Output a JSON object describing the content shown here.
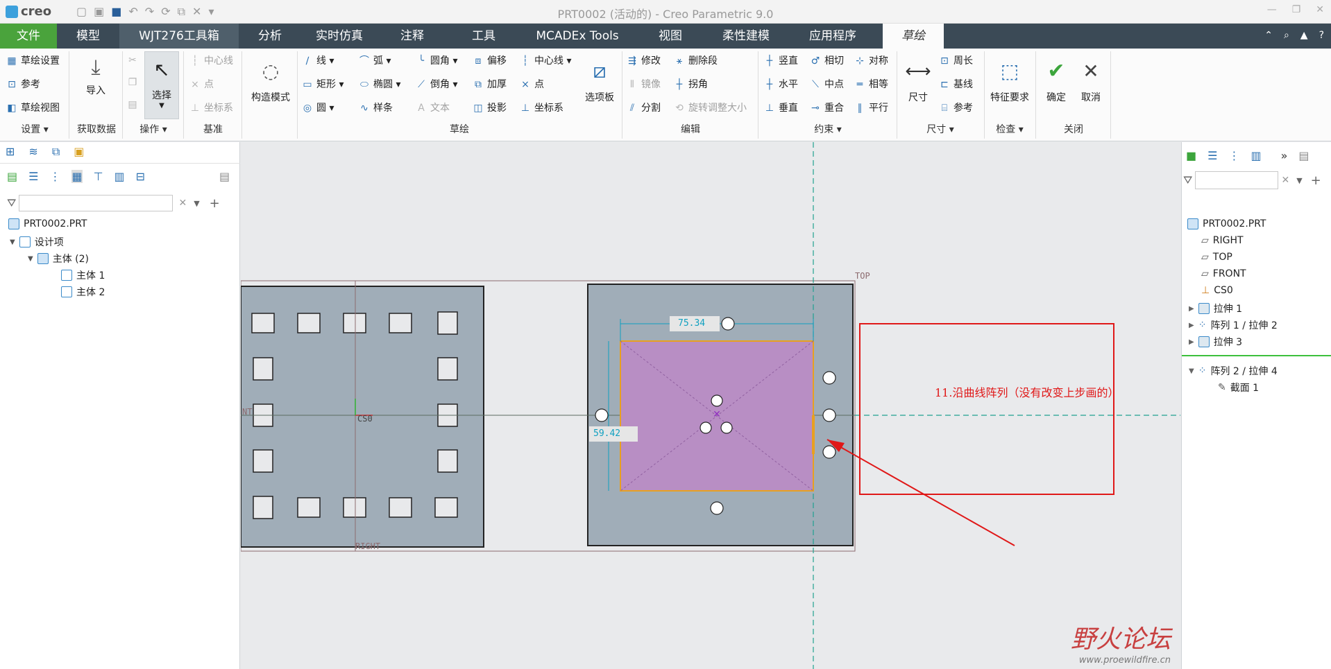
{
  "app": {
    "logo": "creo",
    "title": "PRT0002 (活动的) - Creo Parametric 9.0"
  },
  "tabs": [
    "文件",
    "模型",
    "WJT276工具箱",
    "分析",
    "实时仿真",
    "注释",
    "工具",
    "MCADEx Tools",
    "视图",
    "柔性建模",
    "应用程序",
    "草绘"
  ],
  "ribbon": {
    "settings": {
      "items": [
        "草绘设置",
        "参考",
        "草绘视图"
      ],
      "group": "设置 ▾"
    },
    "getdata": {
      "import": "导入",
      "group": "获取数据"
    },
    "ops": {
      "select": "选择",
      "group": "操作 ▾"
    },
    "datum": {
      "items": [
        "中心线",
        "点",
        "坐标系"
      ],
      "group": "基准"
    },
    "construct": "构造模式",
    "sketch": {
      "col1": [
        "线 ▾",
        "矩形 ▾",
        "圆 ▾"
      ],
      "col2": [
        "弧 ▾",
        "椭圆 ▾",
        "样条"
      ],
      "col3": [
        "圆角 ▾",
        "倒角 ▾",
        "文本"
      ],
      "col4": [
        "偏移",
        "加厚",
        "投影"
      ],
      "col5": [
        "中心线 ▾",
        "点",
        "坐标系"
      ],
      "palette": "选项板",
      "group": "草绘"
    },
    "edit": {
      "items": [
        "修改",
        "镜像",
        "分割"
      ],
      "items2": [
        "删除段",
        "拐角",
        "旋转调整大小"
      ],
      "group": "编辑"
    },
    "constraint": {
      "items": [
        "竖直",
        "水平",
        "垂直"
      ],
      "items2": [
        "相切",
        "中点",
        "重合"
      ],
      "items3": [
        "对称",
        "相等",
        "平行"
      ],
      "group": "约束 ▾"
    },
    "dimension": {
      "main": "尺寸",
      "items": [
        "周长",
        "基线",
        "参考"
      ],
      "group": "尺寸 ▾"
    },
    "inspect": {
      "main": "特征要求",
      "group": "检查 ▾"
    },
    "close": {
      "ok": "确定",
      "cancel": "取消",
      "group": "关闭"
    }
  },
  "left_tree": {
    "root": "PRT0002.PRT",
    "design": "设计项",
    "bodies": "主体 (2)",
    "body1": "主体 1",
    "body2": "主体 2"
  },
  "right_tree": {
    "root": "PRT0002.PRT",
    "items": [
      "RIGHT",
      "TOP",
      "FRONT",
      "CS0",
      "拉伸 1",
      "阵列 1 / 拉伸 2",
      "拉伸 3",
      "阵列 2 / 拉伸 4",
      "截面 1"
    ]
  },
  "canvas": {
    "dim_width": "75.34",
    "dim_height": "59.42",
    "label_top": "TOP",
    "label_right": "RIGHT",
    "label_cs": "CS0",
    "label_nt": "NT",
    "annotation": "11.沿曲线阵列（没有改变上步画的）"
  },
  "watermark": {
    "brand": "野火论坛",
    "url": "www.proewildfire.cn"
  },
  "colors": {
    "ribbon_tab": "#3b4a56",
    "file_tab": "#4aa33c",
    "sketch_fill": "#b88ec4",
    "annotation": "#e01818"
  }
}
